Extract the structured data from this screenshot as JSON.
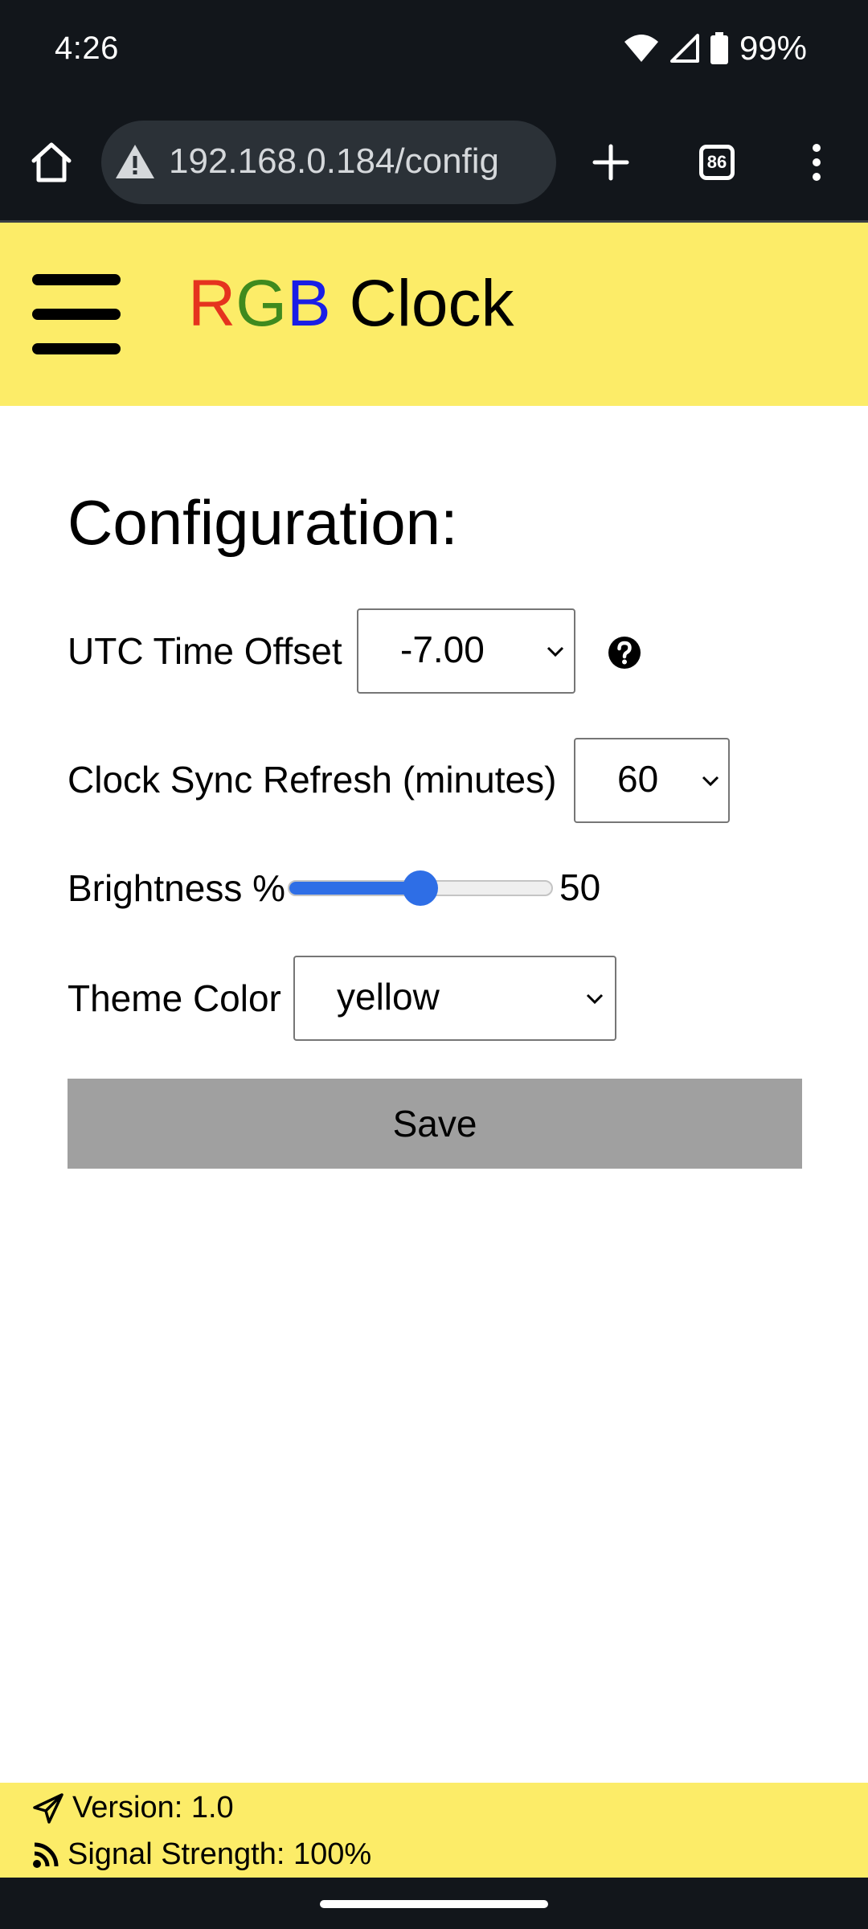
{
  "status_bar": {
    "time": "4:26",
    "battery": "99%"
  },
  "browser": {
    "url": "192.168.0.184/config",
    "tab_count": "86"
  },
  "header": {
    "title_r": "R",
    "title_g": "G",
    "title_b": "B",
    "title_rest": " Clock",
    "color": "#fcec68"
  },
  "config": {
    "heading": "Configuration:",
    "utc_offset": {
      "label": "UTC Time Offset",
      "value": "-7.00"
    },
    "sync_refresh": {
      "label": "Clock Sync Refresh (minutes)",
      "value": "60"
    },
    "brightness": {
      "label": "Brightness %",
      "value": "50",
      "percent": 50
    },
    "theme_color": {
      "label": "Theme Color",
      "value": "yellow"
    },
    "save_label": "Save"
  },
  "footer": {
    "version": "Version: 1.0",
    "signal": "Signal Strength: 100%"
  },
  "colors": {
    "slider_accent": "#2e6ee6",
    "save_button": "#a0a0a0",
    "title_red": "#e5331e",
    "title_green": "#3f8a1e",
    "title_blue": "#1a1ee6"
  }
}
